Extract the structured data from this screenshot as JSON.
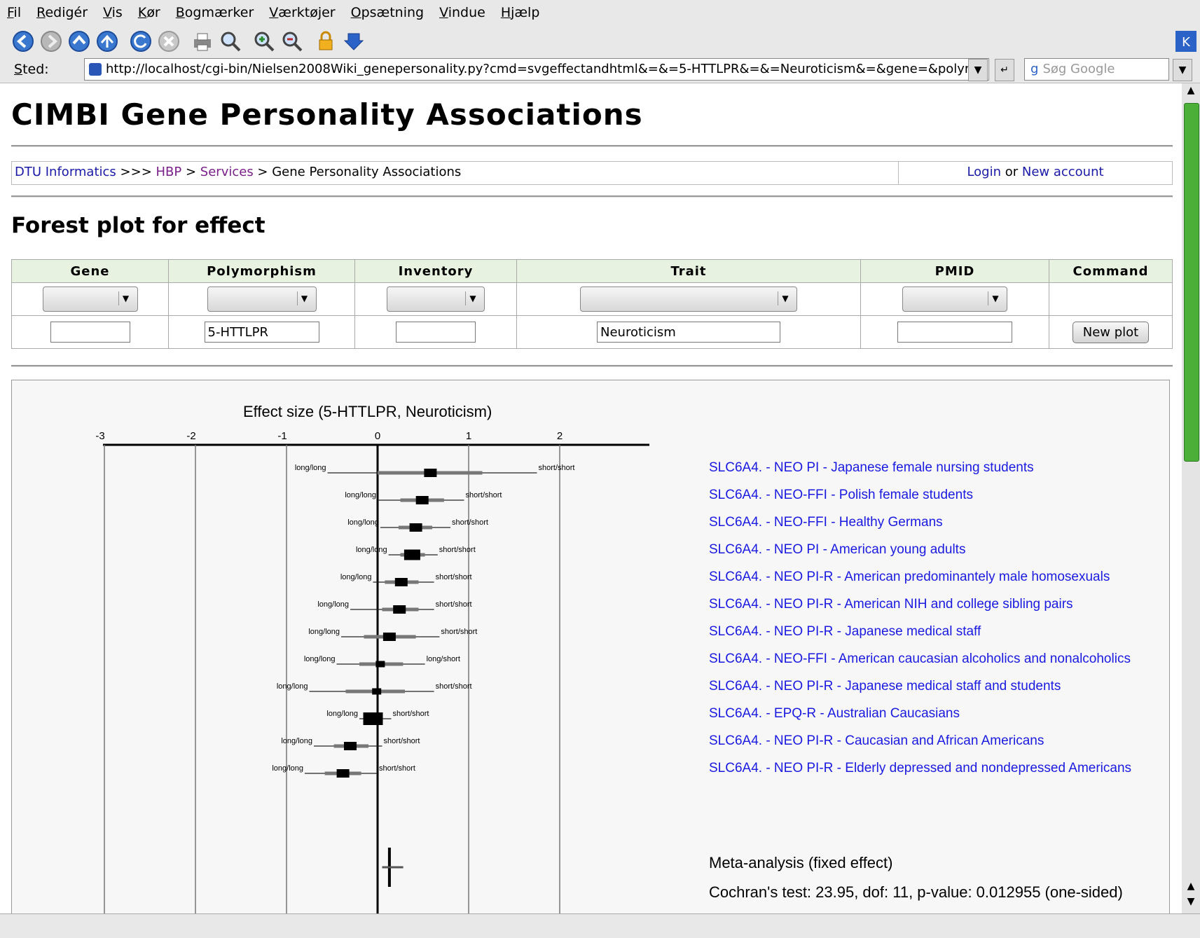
{
  "menu": {
    "items": [
      {
        "u": "F",
        "rest": "il"
      },
      {
        "u": "R",
        "rest": "edigér"
      },
      {
        "u": "V",
        "rest": "is"
      },
      {
        "u": "K",
        "rest": "ør"
      },
      {
        "u": "B",
        "rest": "ogmærker"
      },
      {
        "u": "V",
        "rest": "ærktøjer"
      },
      {
        "u": "O",
        "rest": "psætning"
      },
      {
        "u": "V",
        "rest": "indue"
      },
      {
        "u": "H",
        "rest": "jælp"
      }
    ]
  },
  "location": {
    "label": "Sted:",
    "url": "http://localhost/cgi-bin/Nielsen2008Wiki_genepersonality.py?cmd=svgeffectandhtml&=&=5-HTTLPR&=&=Neuroticism&=&gene=&polymo",
    "search_placeholder": "Søg Google"
  },
  "page": {
    "title": "CIMBI Gene Personality Associations",
    "breadcrumb": {
      "dtu": "DTU Informatics",
      "sep1": " >>> ",
      "hbp": "HBP",
      "sep2": " > ",
      "services": "Services",
      "sep3": " > ",
      "current": "Gene Personality Associations"
    },
    "auth": {
      "login": "Login",
      "or": " or ",
      "new_account": "New account"
    },
    "subtitle": "Forest plot for effect"
  },
  "form": {
    "headers": [
      "Gene",
      "Polymorphism",
      "Inventory",
      "Trait",
      "PMID",
      "Command"
    ],
    "values": {
      "gene": "",
      "polymorphism": "5-HTTLPR",
      "inventory": "",
      "trait": "Neuroticism",
      "pmid": ""
    },
    "button": "New plot"
  },
  "chart_data": {
    "type": "forest",
    "title": "Effect size (5-HTTLPR, Neuroticism)",
    "xlim": [
      -3,
      3
    ],
    "ticks": [
      "-3",
      "-2",
      "-1",
      "0",
      "1",
      "2"
    ],
    "studies": [
      {
        "label": "SLC6A4. - NEO PI - Japanese female nursing students",
        "effect": 0.58,
        "ci": [
          0.0,
          1.15
        ],
        "whisker": [
          -0.55,
          1.75
        ],
        "weight": 2,
        "left": "long/long",
        "right": "short/short"
      },
      {
        "label": "SLC6A4. - NEO-FFI - Polish female students",
        "effect": 0.49,
        "ci": [
          0.25,
          0.73
        ],
        "whisker": [
          0.0,
          0.95
        ],
        "weight": 2,
        "left": "long/long",
        "right": "short/short"
      },
      {
        "label": "SLC6A4. - NEO-FFI - Healthy Germans",
        "effect": 0.42,
        "ci": [
          0.23,
          0.6
        ],
        "whisker": [
          0.03,
          0.8
        ],
        "weight": 2,
        "left": "long/long",
        "right": "short/short"
      },
      {
        "label": "SLC6A4. - NEO PI - American young adults",
        "effect": 0.38,
        "ci": [
          0.25,
          0.52
        ],
        "whisker": [
          0.12,
          0.66
        ],
        "weight": 3,
        "left": "long/long",
        "right": "short/short"
      },
      {
        "label": "SLC6A4. - NEO PI-R - American predominantely male homosexuals",
        "effect": 0.26,
        "ci": [
          0.08,
          0.45
        ],
        "whisker": [
          -0.05,
          0.62
        ],
        "weight": 2,
        "left": "long/long",
        "right": "short/short"
      },
      {
        "label": "SLC6A4. - NEO PI-R - American NIH and college sibling pairs",
        "effect": 0.24,
        "ci": [
          0.05,
          0.45
        ],
        "whisker": [
          -0.3,
          0.62
        ],
        "weight": 2,
        "left": "long/long",
        "right": "short/short"
      },
      {
        "label": "SLC6A4. - NEO PI-R - Japanese medical staff",
        "effect": 0.13,
        "ci": [
          -0.15,
          0.42
        ],
        "whisker": [
          -0.4,
          0.68
        ],
        "weight": 2,
        "left": "long/long",
        "right": "short/short"
      },
      {
        "label": "SLC6A4. - NEO-FFI - American caucasian alcoholics and nonalcoholics",
        "effect": 0.03,
        "ci": [
          -0.2,
          0.28
        ],
        "whisker": [
          -0.45,
          0.52
        ],
        "weight": 1,
        "left": "long/long",
        "right": "long/short"
      },
      {
        "label": "SLC6A4. - NEO PI-R - Japanese medical staff and students",
        "effect": -0.01,
        "ci": [
          -0.35,
          0.3
        ],
        "whisker": [
          -0.75,
          0.62
        ],
        "weight": 1,
        "left": "long/long",
        "right": "short/short"
      },
      {
        "label": "SLC6A4. - EPQ-R - Australian Caucasians",
        "effect": -0.05,
        "ci": [
          -0.11,
          0.02
        ],
        "whisker": [
          -0.2,
          0.15
        ],
        "weight": 4,
        "left": "long/long",
        "right": "short/short"
      },
      {
        "label": "SLC6A4. - NEO PI-R - Caucasian and African Americans",
        "effect": -0.3,
        "ci": [
          -0.48,
          -0.1
        ],
        "whisker": [
          -0.7,
          0.05
        ],
        "weight": 2,
        "left": "long/long",
        "right": "short/short"
      },
      {
        "label": "SLC6A4. - NEO PI-R - Elderly depressed and nondepressed Americans",
        "effect": -0.38,
        "ci": [
          -0.58,
          -0.18
        ],
        "whisker": [
          -0.8,
          0.0
        ],
        "weight": 2,
        "left": "long/long",
        "right": "short/short"
      }
    ],
    "meta": {
      "label": "Meta-analysis (fixed effect)",
      "effect": 0.13,
      "ci": [
        0.05,
        0.22
      ],
      "cochran": "Cochran's test: 23.95, dof: 11, p-value: 0.012955 (one-sided)"
    }
  }
}
